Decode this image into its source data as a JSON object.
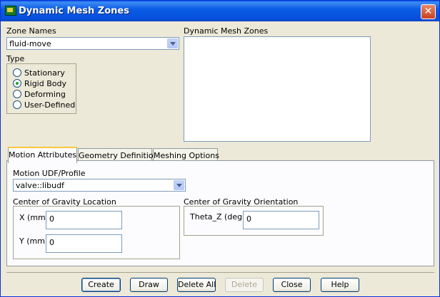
{
  "window": {
    "title": "Dynamic Mesh Zones",
    "close_label": "✕"
  },
  "zone_names": {
    "label": "Zone Names",
    "selected": "fluid-move"
  },
  "type": {
    "label": "Type",
    "options": [
      {
        "label": "Stationary",
        "selected": false
      },
      {
        "label": "Rigid Body",
        "selected": true
      },
      {
        "label": "Deforming",
        "selected": false
      },
      {
        "label": "User-Defined",
        "selected": false
      }
    ]
  },
  "dynamic_mesh_zones": {
    "label": "Dynamic Mesh Zones",
    "items": []
  },
  "tabs": [
    {
      "label": "Motion Attributes",
      "active": true
    },
    {
      "label": "Geometry Definition",
      "active": false
    },
    {
      "label": "Meshing Options",
      "active": false
    }
  ],
  "motion": {
    "udf_label": "Motion UDF/Profile",
    "udf_selected": "valve::libudf",
    "cog_location": {
      "label": "Center of Gravity Location",
      "x_label": "X (mm)",
      "x_value": "0",
      "y_label": "Y (mm)",
      "y_value": "0"
    },
    "cog_orientation": {
      "label": "Center of Gravity Orientation",
      "theta_label": "Theta_Z (deg)",
      "theta_value": "0"
    }
  },
  "buttons": {
    "create": "Create",
    "draw": "Draw",
    "delete_all": "Delete All",
    "delete": "Delete",
    "close": "Close",
    "help": "Help"
  }
}
